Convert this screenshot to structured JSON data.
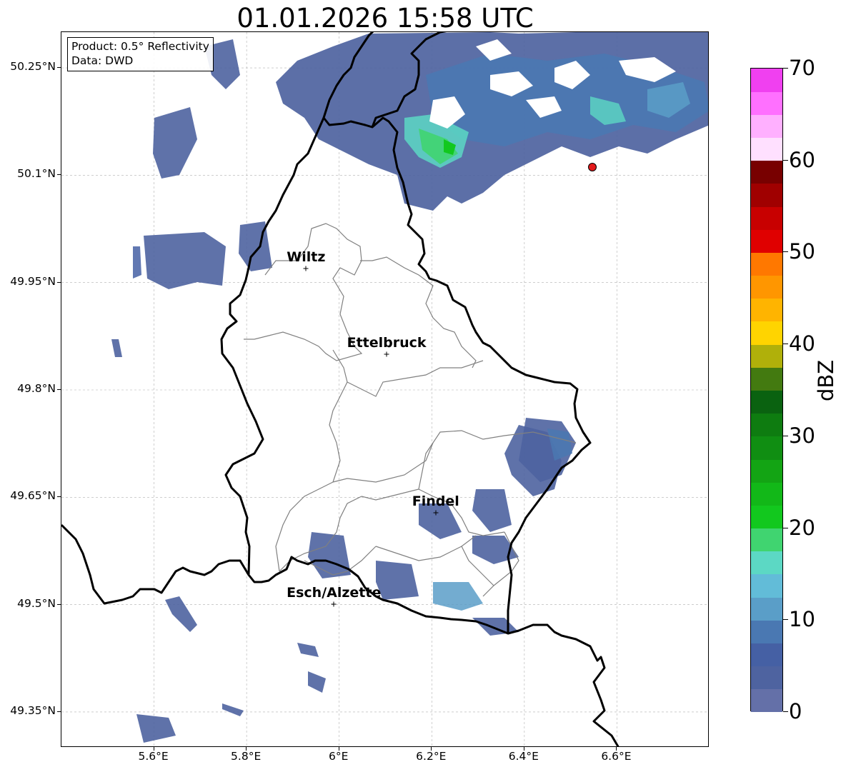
{
  "title": "01.01.2026 15:58 UTC",
  "info": {
    "product": "Product: 0.5° Reflectivity",
    "source": "Data: DWD"
  },
  "axes": {
    "lat_labels": [
      "50.25°N",
      "50.1°N",
      "49.95°N",
      "49.8°N",
      "49.65°N",
      "49.5°N",
      "49.35°N"
    ],
    "lat_values": [
      50.25,
      50.1,
      49.95,
      49.8,
      49.65,
      49.5,
      49.35
    ],
    "lon_labels": [
      "5.6°E",
      "5.8°E",
      "6°E",
      "6.2°E",
      "6.4°E",
      "6.6°E"
    ],
    "lon_values": [
      5.6,
      5.8,
      6.0,
      6.2,
      6.4,
      6.6
    ],
    "extent": {
      "lon_min": 5.4,
      "lon_max": 6.8,
      "lat_min": 49.3,
      "lat_max": 50.3
    },
    "grid": true
  },
  "cities": [
    {
      "name": "Wiltz",
      "lon": 5.93,
      "lat": 49.969
    },
    {
      "name": "Ettelbruck",
      "lon": 6.104,
      "lat": 49.849
    },
    {
      "name": "Findel",
      "lon": 6.21,
      "lat": 49.627
    },
    {
      "name": "Esch/Alzette",
      "lon": 5.99,
      "lat": 49.5
    }
  ],
  "radar_site": {
    "lon": 6.548,
    "lat": 50.11,
    "color": "#e31a1c"
  },
  "colorbar": {
    "label": "dBZ",
    "min": 0,
    "max": 70,
    "ticks": [
      "0",
      "10",
      "20",
      "30",
      "40",
      "50",
      "60",
      "70"
    ],
    "tick_values": [
      0,
      10,
      20,
      30,
      40,
      50,
      60,
      70
    ],
    "step": 2.5,
    "colors": [
      "#6470a8",
      "#4e63a0",
      "#4560a4",
      "#4a78b2",
      "#5a9ec8",
      "#62bcd8",
      "#5cd8c4",
      "#40d470",
      "#12c81e",
      "#12b818",
      "#13a414",
      "#108e12",
      "#0e7c10",
      "#0a6210",
      "#437a10",
      "#b0b00a",
      "#ffd400",
      "#ffb400",
      "#ff9600",
      "#ff7800",
      "#e00000",
      "#c80000",
      "#a00000",
      "#780000",
      "#ffe0ff",
      "#ffb0ff",
      "#ff70ff",
      "#f040f0"
    ]
  },
  "colors": {
    "country_border": "#000000",
    "canton_border": "#808080",
    "grid": "#b0b0b0"
  }
}
